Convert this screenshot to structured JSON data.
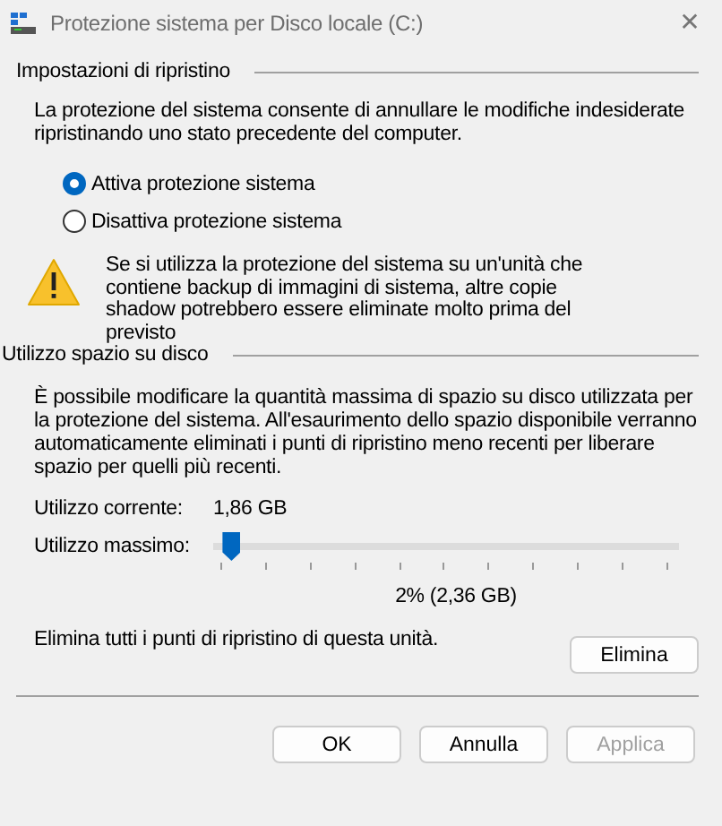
{
  "window": {
    "title": "Protezione sistema per Disco locale (C:)",
    "close": "✕"
  },
  "restore_settings": {
    "heading": "Impostazioni di ripristino",
    "description": "La protezione del sistema consente di annullare le modifiche indesiderate ripristinando uno stato precedente del computer.",
    "options": [
      {
        "label": "Attiva protezione sistema",
        "selected": true
      },
      {
        "label": "Disattiva protezione sistema",
        "selected": false
      }
    ],
    "warning": "Se si utilizza la protezione del sistema su un'unità che contiene backup di immagini di sistema, altre copie shadow potrebbero essere eliminate molto prima del previsto"
  },
  "disk_usage": {
    "heading": "Utilizzo spazio su disco",
    "description": "È possibile modificare la quantità massima di spazio su disco utilizzata per la protezione del sistema. All'esaurimento dello spazio disponibile verranno automaticamente eliminati i punti di ripristino meno recenti per liberare spazio per quelli più recenti.",
    "current_label": "Utilizzo corrente:",
    "current_value": "1,86 GB",
    "max_label": "Utilizzo massimo:",
    "level": 0.02,
    "max_value": "2% (2,36 GB)",
    "delete_text": "Elimina tutti i punti di ripristino di questa unità.",
    "delete_button": "Elimina"
  },
  "buttons": [
    {
      "label": "OK",
      "disabled": false
    },
    {
      "label": "Annulla",
      "disabled": false
    },
    {
      "label": "Applica",
      "disabled": true
    }
  ]
}
